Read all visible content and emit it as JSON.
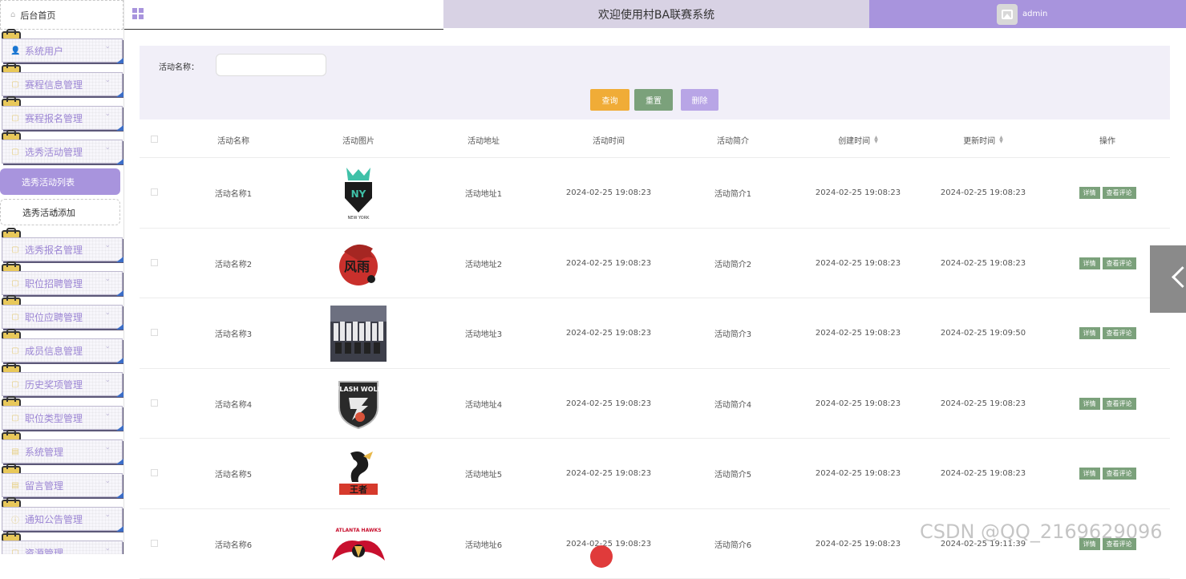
{
  "sidebar": {
    "home_label": "后台首页",
    "items": [
      {
        "label": "系统用户",
        "icon": "user-icon"
      },
      {
        "label": "赛程信息管理",
        "icon": "folder-icon"
      },
      {
        "label": "赛程报名管理",
        "icon": "folder-icon"
      },
      {
        "label": "选秀活动管理",
        "icon": "folder-icon"
      },
      {
        "label": "选秀报名管理",
        "icon": "folder-icon"
      },
      {
        "label": "职位招聘管理",
        "icon": "folder-icon"
      },
      {
        "label": "职位应聘管理",
        "icon": "folder-icon"
      },
      {
        "label": "成员信息管理",
        "icon": "folder-icon"
      },
      {
        "label": "历史奖项管理",
        "icon": "folder-icon"
      },
      {
        "label": "职位类型管理",
        "icon": "folder-icon"
      },
      {
        "label": "系统管理",
        "icon": "list-icon"
      },
      {
        "label": "留言管理",
        "icon": "list-icon"
      },
      {
        "label": "通知公告管理",
        "icon": "info-icon"
      },
      {
        "label": "资源管理",
        "icon": "folder-icon"
      }
    ],
    "sub_items": {
      "active": "选秀活动列表",
      "normal": "选秀活动添加"
    }
  },
  "header": {
    "title": "欢迎使用村BA联赛系统",
    "username": "admin"
  },
  "search": {
    "label": "活动名称：",
    "value": "",
    "query_btn": "查询",
    "reset_btn": "重置",
    "delete_btn": "删除"
  },
  "table": {
    "columns": [
      "活动名称",
      "活动图片",
      "活动地址",
      "活动时间",
      "活动简介",
      "创建时间",
      "更新时间",
      "操作"
    ],
    "action_detail": "详情",
    "action_comments": "查看评论",
    "rows": [
      {
        "name": "活动名称1",
        "logo": "liberty-logo",
        "address": "活动地址1",
        "time": "2024-02-25 19:08:23",
        "intro": "活动简介1",
        "created": "2024-02-25 19:08:23",
        "updated": "2024-02-25 19:08:23"
      },
      {
        "name": "活动名称2",
        "logo": "fengyun-logo",
        "address": "活动地址2",
        "time": "2024-02-25 19:08:23",
        "intro": "活动简介2",
        "created": "2024-02-25 19:08:23",
        "updated": "2024-02-25 19:08:23"
      },
      {
        "name": "活动名称3",
        "logo": "team-photo",
        "address": "活动地址3",
        "time": "2024-02-25 19:08:23",
        "intro": "活动简介3",
        "created": "2024-02-25 19:08:23",
        "updated": "2024-02-25 19:09:50"
      },
      {
        "name": "活动名称4",
        "logo": "flash-wolf-logo",
        "address": "活动地址4",
        "time": "2024-02-25 19:08:23",
        "intro": "活动简介4",
        "created": "2024-02-25 19:08:23",
        "updated": "2024-02-25 19:08:23"
      },
      {
        "name": "活动名称5",
        "logo": "dragon-logo",
        "address": "活动地址5",
        "time": "2024-02-25 19:08:23",
        "intro": "活动简介5",
        "created": "2024-02-25 19:08:23",
        "updated": "2024-02-25 19:08:23"
      },
      {
        "name": "活动名称6",
        "logo": "hawks-logo",
        "address": "活动地址6",
        "time": "2024-02-25 19:08:23",
        "intro": "活动简介6",
        "created": "2024-02-25 19:08:23",
        "updated": "2024-02-25 19:11:39"
      }
    ]
  },
  "watermark": "CSDN @QQ_2169629096",
  "colors": {
    "accent": "#a894dd",
    "title_bar": "#d8d2e4",
    "query": "#f0ac37",
    "reset": "#7ba17b",
    "delete": "#b8a5e6"
  }
}
